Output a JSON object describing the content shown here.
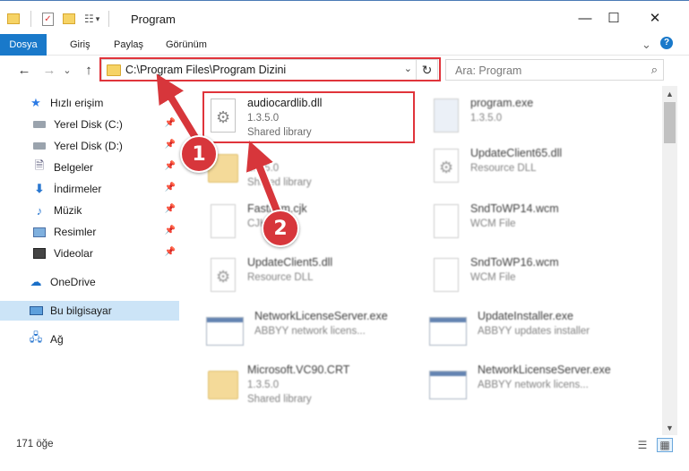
{
  "window": {
    "title": "Program",
    "minimize": "—",
    "maximize": "☐",
    "close": "✕"
  },
  "ribbon": {
    "tabs": [
      "Dosya",
      "Giriş",
      "Paylaş",
      "Görünüm"
    ],
    "expand": "⌄",
    "help": "?"
  },
  "nav": {
    "back": "←",
    "forward": "→",
    "recent": "⌄",
    "up": "↑",
    "address": "C:\\Program Files\\Program Dizini",
    "address_dropdown": "⌄",
    "refresh": "↻",
    "search_placeholder": "Ara: Program",
    "search_icon": "⌕"
  },
  "sidebar": {
    "items": [
      {
        "label": "Hızlı erişim",
        "icon": "star-icon"
      },
      {
        "label": "Yerel Disk (C:)",
        "icon": "drive-icon",
        "pinned": true
      },
      {
        "label": "Yerel Disk (D:)",
        "icon": "drive-icon",
        "pinned": true
      },
      {
        "label": "Belgeler",
        "icon": "documents-icon",
        "pinned": true
      },
      {
        "label": "İndirmeler",
        "icon": "downloads-icon",
        "pinned": true
      },
      {
        "label": "Müzik",
        "icon": "music-icon",
        "pinned": true
      },
      {
        "label": "Resimler",
        "icon": "pictures-icon",
        "pinned": true
      },
      {
        "label": "Videolar",
        "icon": "videos-icon",
        "pinned": true
      },
      {
        "label": "OneDrive",
        "icon": "cloud-icon"
      },
      {
        "label": "Bu bilgisayar",
        "icon": "computer-icon",
        "selected": true
      },
      {
        "label": "Ağ",
        "icon": "network-icon"
      }
    ]
  },
  "files": [
    {
      "name": "audiocardlib.dll",
      "version": "1.3.5.0",
      "type": "Shared library",
      "icon": "dll-icon"
    },
    {
      "name": "program.exe",
      "version": "1.3.5.0",
      "type": "",
      "icon": "exe-icon"
    },
    {
      "name": "",
      "version": "1.3.5.0",
      "type": "Shared library",
      "icon": "folder-icon"
    },
    {
      "name": "UpdateClient65.dll",
      "version": "Resource DLL",
      "type": "",
      "icon": "dll-icon"
    },
    {
      "name": "Fastlyrm.cjk",
      "version": "CJK File",
      "type": "",
      "icon": "file-icon"
    },
    {
      "name": "SndToWP14.wcm",
      "version": "WCM File",
      "type": "",
      "icon": "file-icon"
    },
    {
      "name": "UpdateClient5.dll",
      "version": "Resource DLL",
      "type": "",
      "icon": "dll-icon"
    },
    {
      "name": "SndToWP16.wcm",
      "version": "WCM File",
      "type": "",
      "icon": "file-icon"
    },
    {
      "name": "NetworkLicenseServer.exe",
      "version": "ABBYY network licens...",
      "type": "",
      "icon": "app-icon"
    },
    {
      "name": "UpdateInstaller.exe",
      "version": "ABBYY updates installer",
      "type": "",
      "icon": "app-icon"
    },
    {
      "name": "Microsoft.VC90.CRT",
      "version": "1.3.5.0",
      "type": "Shared library",
      "icon": "folder-icon"
    },
    {
      "name": "NetworkLicenseServer.exe",
      "version": "ABBYY network licens...",
      "type": "",
      "icon": "app-icon"
    }
  ],
  "status": {
    "count": "171 öğe"
  },
  "callouts": [
    "1",
    "2"
  ],
  "colors": {
    "accent": "#1979ca",
    "highlight": "#e0343b",
    "selected": "#cce4f7"
  }
}
